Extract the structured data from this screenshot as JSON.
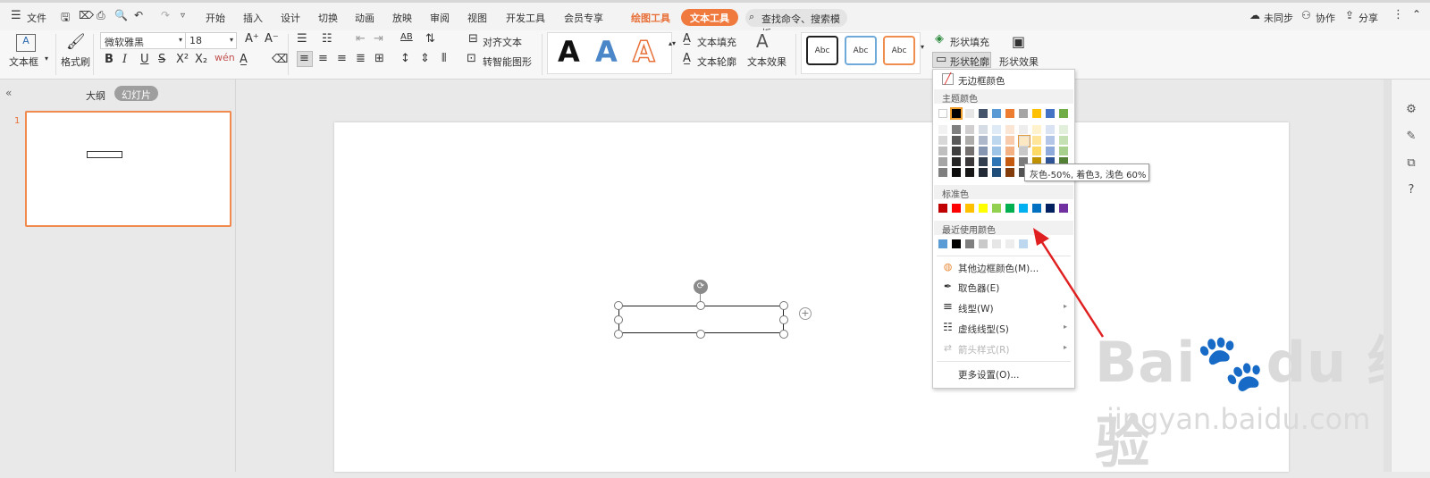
{
  "menubar": {
    "file_label": "文件",
    "tabs": [
      "开始",
      "插入",
      "设计",
      "切换",
      "动画",
      "放映",
      "审阅",
      "视图",
      "开发工具",
      "会员专享"
    ],
    "drawing_tools": "绘图工具",
    "text_tools": "文本工具",
    "search_placeholder": "查找命令、搜索模板",
    "right": {
      "sync": "未同步",
      "collab": "协作",
      "share": "分享"
    }
  },
  "ribbon": {
    "textbox": "文本框",
    "format_painter": "格式刷",
    "font_name": "微软雅黑",
    "font_size": "18",
    "align_text": "对齐文本",
    "smart_art": "转智能图形",
    "text_fill": "文本填充",
    "text_outline": "文本轮廓",
    "text_effect": "文本效果",
    "shape_fill": "形状填充",
    "shape_outline": "形状轮廓",
    "shape_effect": "形状效果",
    "style_abc": "Abc",
    "big_a": "A"
  },
  "leftpane": {
    "outline": "大纲",
    "slides": "幻灯片",
    "slide_number": "1"
  },
  "dropdown": {
    "no_border": "无边框颜色",
    "theme_colors": "主题颜色",
    "standard_colors": "标准色",
    "recent_colors": "最近使用颜色",
    "more_colors": "其他边框颜色(M)...",
    "eyedropper": "取色器(E)",
    "line_type": "线型(W)",
    "dash_type": "虚线线型(S)",
    "arrow_style": "箭头样式(R)",
    "more_settings": "更多设置(O)...",
    "theme_top_row": [
      "#ffffff",
      "#000000",
      "#e7e6e6",
      "#44546a",
      "#5b9bd5",
      "#ed7d31",
      "#a5a5a5",
      "#ffc000",
      "#4472c4",
      "#70ad47"
    ],
    "theme_shades": [
      [
        "#f2f2f2",
        "#7f7f7f",
        "#d0cece",
        "#d6dce4",
        "#deebf6",
        "#fbe5d5",
        "#ededed",
        "#fff2cc",
        "#dae3f3",
        "#e2efda"
      ],
      [
        "#d8d8d8",
        "#595959",
        "#aeabab",
        "#adb9ca",
        "#bdd7ee",
        "#f8cbad",
        "#dbdbdb",
        "#fee599",
        "#b4c6e7",
        "#c5e0b3"
      ],
      [
        "#bfbfbf",
        "#3f3f3f",
        "#757070",
        "#8496b0",
        "#9dc3e6",
        "#f4b183",
        "#c9c9c9",
        "#ffd965",
        "#8eaadb",
        "#a8d08d"
      ],
      [
        "#a5a5a5",
        "#262626",
        "#3a3838",
        "#323f4f",
        "#2e75b5",
        "#c55a11",
        "#7b7b7b",
        "#bf9000",
        "#2f5496",
        "#538135"
      ],
      [
        "#7f7f7f",
        "#0c0c0c",
        "#171616",
        "#222a35",
        "#1e4e79",
        "#833c0b",
        "#525252",
        "#7f6000",
        "#1f3864",
        "#375623"
      ]
    ],
    "standard": [
      "#c00000",
      "#ff0000",
      "#ffc000",
      "#ffff00",
      "#92d050",
      "#00b050",
      "#00b0f0",
      "#0070c0",
      "#002060",
      "#7030a0"
    ],
    "recent": [
      "#5b9bd5",
      "#000000",
      "#7f7f7f",
      "#c9c9c9",
      "#e7e6e6",
      "#ededed",
      "#bdd7ee"
    ]
  },
  "tooltip": "灰色-50%, 着色3, 浅色 60%",
  "watermark": {
    "line1": "Bai du 经验",
    "line2": "jingyan.baidu.com"
  }
}
